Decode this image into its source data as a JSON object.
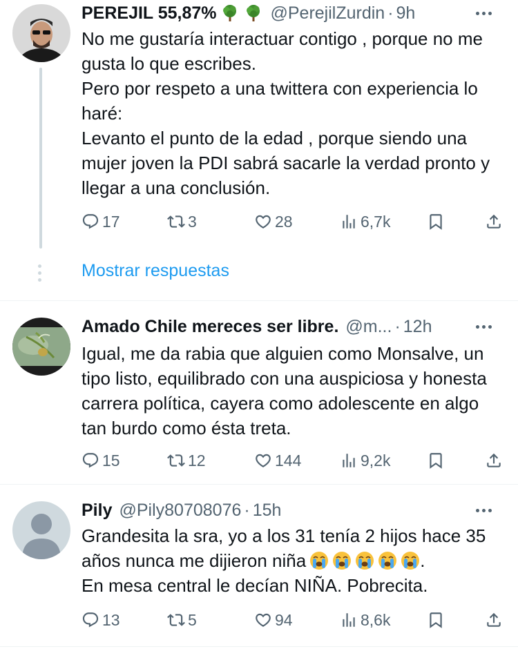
{
  "tweets": [
    {
      "name": "PEREJIL 55,87%",
      "name_emojis": [
        "tree",
        "tree"
      ],
      "handle": "@PerejilZurdin",
      "time": "9h",
      "text": "No me gustaría interactuar contigo , porque no me gusta lo que escribes.\nPero por respeto a una twittera con experiencia lo haré:\nLevanto el punto de la edad , porque siendo una mujer joven la PDI sabrá sacarle la verdad pronto y llegar a una conclusión.",
      "replies": "17",
      "retweets": "3",
      "likes": "28",
      "views": "6,7k"
    },
    {
      "name": "Amado Chile mereces ser libre.",
      "handle": "@m...",
      "time": "12h",
      "text": "Igual, me da rabia que alguien como Monsalve, un tipo listo, equilibrado con una auspiciosa y honesta carrera política, cayera como adolescente en algo tan burdo como ésta treta.",
      "replies": "15",
      "retweets": "12",
      "likes": "144",
      "views": "9,2k"
    },
    {
      "name": "Pily",
      "handle": "@Pily80708076",
      "time": "15h",
      "text": "Grandesita la sra, yo a los 31 tenía 2 hijos hace 35 años nunca me dijieron niña",
      "text_emojis": [
        "loudly-crying-face",
        "loudly-crying-face",
        "loudly-crying-face",
        "loudly-crying-face",
        "loudly-crying-face"
      ],
      "text_after": ".\nEn mesa central le decían NIÑA. Pobrecita.",
      "replies": "13",
      "retweets": "5",
      "likes": "94",
      "views": "8,6k"
    }
  ],
  "show_replies_label": "Mostrar respuestas",
  "separator_dot": "·",
  "colors": {
    "accent": "#1d9bf0",
    "muted": "#536471",
    "text": "#0f1419"
  }
}
